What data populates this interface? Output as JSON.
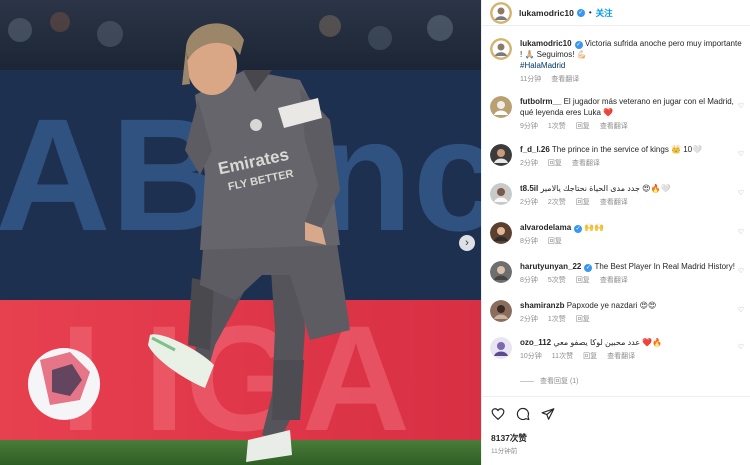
{
  "post": {
    "username": "lukamodric10",
    "follow_label": "关注",
    "separator": "•",
    "next_arrow": "›",
    "likes": "8137次赞",
    "time_ago": "11分钟前"
  },
  "caption": {
    "username": "lukamodric10",
    "text": "Victoria sufrida anoche pero muy importante ! 🙏🏼 Seguimos! 💪🏻",
    "hashtag": "#HalaMadrid",
    "time": "11分钟",
    "translate": "查看翻译"
  },
  "comments": [
    {
      "username": "futbolrm__",
      "text": "El jugador más veterano en jugar con el Madrid, qué leyenda eres Luka ❤️",
      "time": "9分钟",
      "likes": "1次赞",
      "reply": "回复",
      "translate": "查看翻译"
    },
    {
      "username": "f_d_l.26",
      "text": "The prince in the service of kings 👑 10🤍",
      "time": "2分钟",
      "likes": "",
      "reply": "回复",
      "translate": "查看翻译"
    },
    {
      "username": "t8.5il",
      "text": "جدد مدى الحياة نحتاجك يالامير 😍🔥🤍",
      "time": "2分钟",
      "likes": "2次赞",
      "reply": "回复",
      "translate": "查看翻译"
    },
    {
      "username": "alvarodelama",
      "text": "🙌🙌",
      "time": "8分钟",
      "likes": "",
      "reply": "回复",
      "translate": ""
    },
    {
      "username": "harutyunyan_22",
      "text": "The Best Player In Real Madrid History!",
      "time": "8分钟",
      "likes": "5次赞",
      "reply": "回复",
      "translate": "查看翻译"
    },
    {
      "username": "shamiranzb",
      "text": "Papxode ye nazdari 😍😍",
      "time": "2分钟",
      "likes": "1次赞",
      "reply": "回复",
      "translate": ""
    },
    {
      "username": "ozo_112",
      "text": "عدد محبين لوكا يصفو معي ❤️🔥",
      "time": "10分钟",
      "likes": "11次赞",
      "reply": "回复",
      "translate": "查看翻译"
    }
  ],
  "view_replies": "查看回复 (1)",
  "colors": {
    "accent": "#0095f6",
    "verified": "#3897f0",
    "meta": "#8e8e8e"
  },
  "icons": [
    "heart-icon",
    "comment-icon",
    "share-icon",
    "verified-icon"
  ]
}
